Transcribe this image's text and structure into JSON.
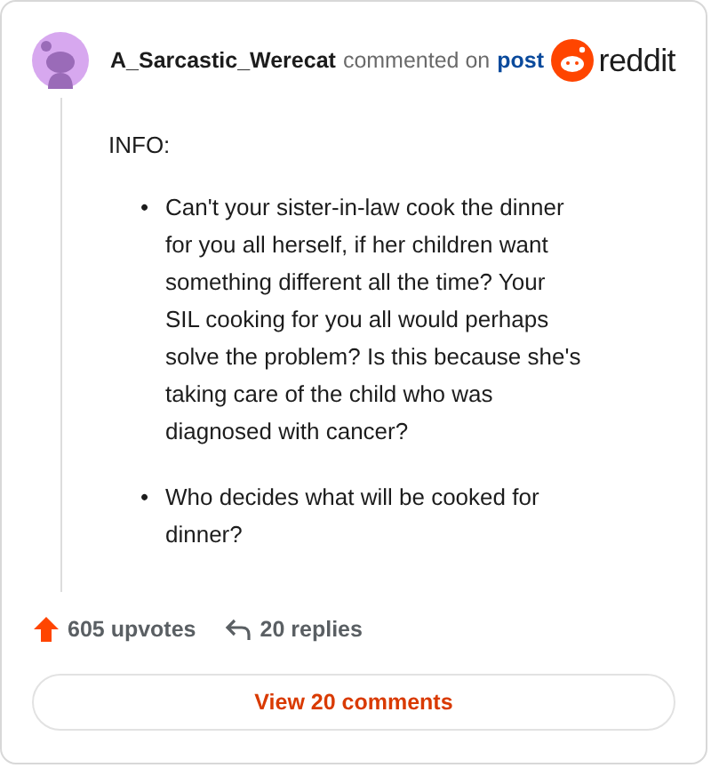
{
  "comment": {
    "author": "A_Sarcastic_Werecat",
    "action": "commented on",
    "link": "post",
    "brand": "reddit",
    "intro": "INFO:",
    "points": [
      {
        "marker": "•",
        "text": "Can't your sister-in-law cook the dinner for you all herself, if her children want something different all the time? Your SIL cooking for you all would perhaps solve the problem? Is this because she's taking care of the child who was diagnosed with cancer?"
      },
      {
        "marker": "•",
        "text": "Who decides what will be cooked for dinner?"
      }
    ]
  },
  "footer": {
    "upvotes": "605 upvotes",
    "replies": "20 replies",
    "button": "View 20 comments"
  }
}
